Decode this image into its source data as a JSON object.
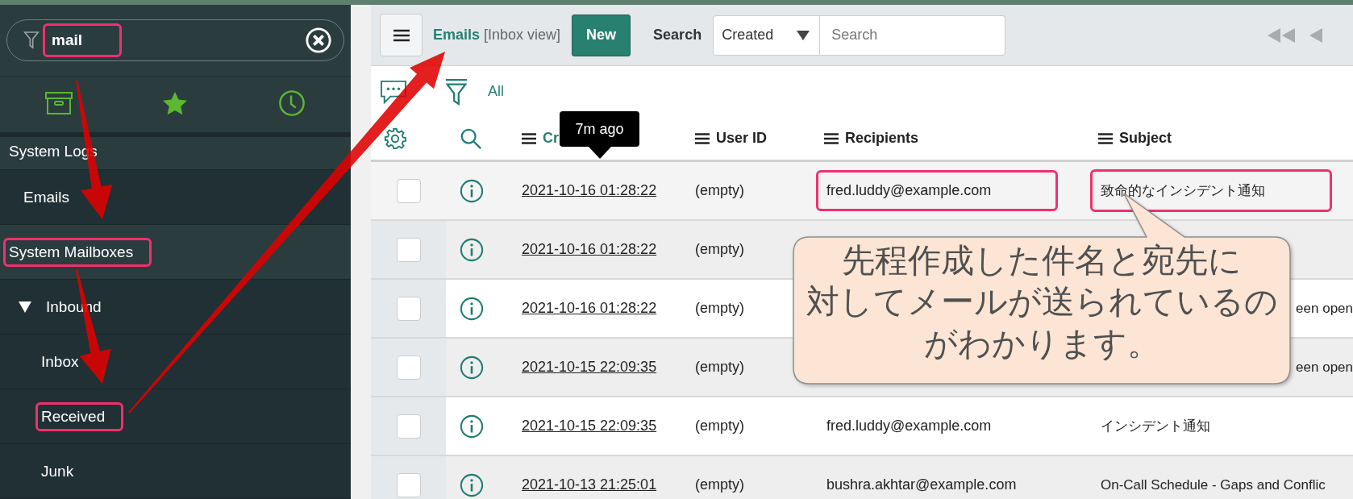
{
  "sidebar": {
    "filter": {
      "value": "mail",
      "highlighted": true
    },
    "nav_tabs": [
      {
        "kind": "archive"
      },
      {
        "kind": "star"
      },
      {
        "kind": "history"
      }
    ],
    "sections": [
      {
        "title": "System Logs",
        "highlighted": false,
        "children": [
          {
            "label": "Emails",
            "highlighted": false
          }
        ]
      },
      {
        "title": "System Mailboxes",
        "highlighted": true,
        "children": [
          {
            "label": "Inbound",
            "highlighted": false,
            "expanded": true,
            "children": [
              {
                "label": "Inbox",
                "highlighted": false
              },
              {
                "label": "Received",
                "highlighted": true
              },
              {
                "label": "Junk",
                "highlighted": false
              }
            ]
          }
        ]
      }
    ]
  },
  "list_header": {
    "title": "Emails",
    "view": "[Inbox view]",
    "new_button": "New",
    "search_label": "Search",
    "search_field": "Created",
    "search_placeholder": "Search"
  },
  "filter_bar": {
    "breadcrumb": "All"
  },
  "table": {
    "columns": [
      {
        "label": "Cr"
      },
      {
        "label": "User ID"
      },
      {
        "label": "Recipients"
      },
      {
        "label": "Subject"
      }
    ],
    "tooltip": "7m ago",
    "rows": [
      {
        "checked": false,
        "hovered": true,
        "covered": false,
        "created": "2021-10-16 01:28:22",
        "user_id": "(empty)",
        "recipients": "fred.luddy@example.com",
        "recipients_highlighted": true,
        "subject": "致命的なインシデント通知",
        "subject_highlighted": true
      },
      {
        "checked": false,
        "hovered": false,
        "created": "2021-10-16 01:28:22",
        "user_id": "(empty)"
      },
      {
        "checked": false,
        "hovered": false,
        "covered": true,
        "created": "2021-10-16 01:28:22",
        "user_id": "(empty)",
        "subject": "een open",
        "subject_highlighted": false
      },
      {
        "checked": false,
        "hovered": false,
        "covered": true,
        "created": "2021-10-15 22:09:35",
        "user_id": "(empty)",
        "subject": "een open",
        "subject_highlighted": false
      },
      {
        "checked": false,
        "hovered": false,
        "covered": false,
        "created": "2021-10-15 22:09:35",
        "user_id": "(empty)",
        "recipients": "fred.luddy@example.com",
        "recipients_highlighted": false,
        "subject": "インシデント通知",
        "subject_highlighted": false
      },
      {
        "checked": false,
        "hovered": false,
        "covered": false,
        "created": "2021-10-13 21:25:01",
        "user_id": "(empty)",
        "recipients": "bushra.akhtar@example.com",
        "recipients_highlighted": false,
        "subject": "On-Call Schedule - Gaps and Conflic",
        "subject_highlighted": false
      }
    ]
  },
  "callout": {
    "lines": [
      "先程作成した件名と宛先に",
      "対してメールが送られているの",
      "がわかります。"
    ]
  }
}
